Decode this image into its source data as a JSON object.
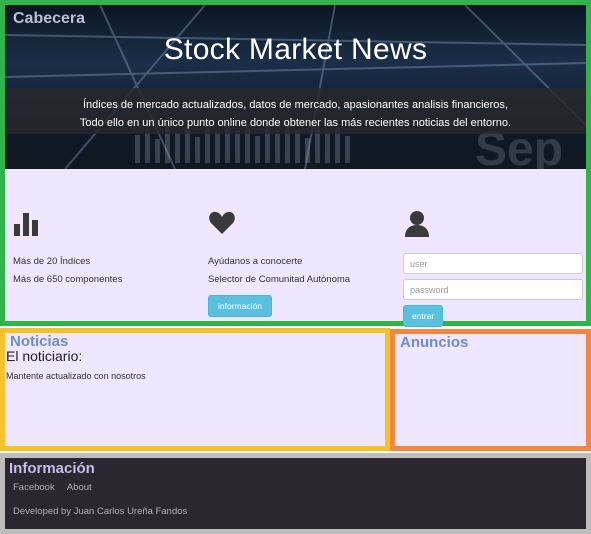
{
  "header": {
    "section_label": "Cabecera",
    "title": "Stock Market News",
    "description_line1": "Índices de mercado actualizados, datos de mercado, apasionantes analisis financieros,",
    "description_line2": "Todo ello en un único punto online donde obtener las más recientes noticias del entorno."
  },
  "features": {
    "indices": {
      "icon": "bar-chart-icon",
      "line1": "Más de 20 Índices",
      "line2": "Más de 650 componentes"
    },
    "community": {
      "icon": "heart-icon",
      "line1": "Ayúdanos a conocerte",
      "line2": "Selector de Comunitad Autònoma",
      "button_label": "información"
    },
    "login": {
      "icon": "user-icon",
      "user_placeholder": "user",
      "password_placeholder": "password",
      "button_label": "entrar"
    }
  },
  "noticias": {
    "title": "Noticias",
    "subtitle": "El noticiario:",
    "text": "Mantente actualizado con nosotros"
  },
  "anuncios": {
    "title": "Anuncios"
  },
  "footer": {
    "title": "Información",
    "links": [
      "Facebook",
      "About"
    ],
    "credit": "Developed by Juan Carlos Ureña Fandos"
  },
  "colors": {
    "header_border": "#2fb34a",
    "noticias_border": "#f6c22a",
    "anuncios_border": "#f5853f",
    "footer_border": "#bdbdbd",
    "button": "#5bc0de",
    "panel_bg": "#efe6ff"
  }
}
